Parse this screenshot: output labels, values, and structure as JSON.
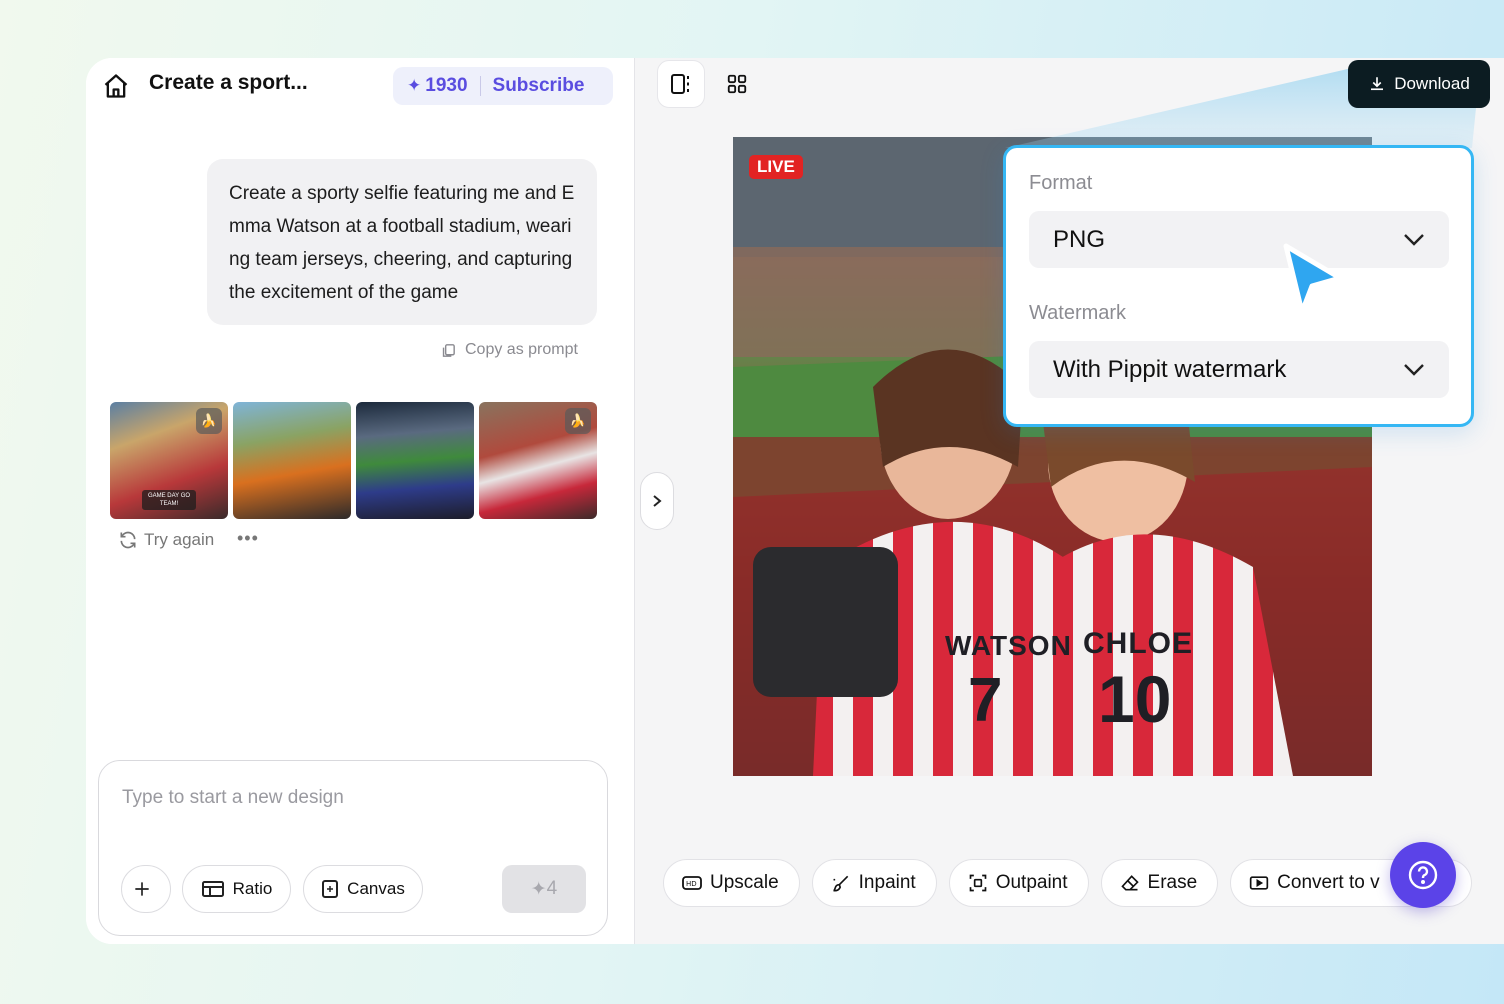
{
  "header": {
    "title": "Create a sport...",
    "credits": "1930",
    "subscribe_label": "Subscribe"
  },
  "chat": {
    "prompt_text": "Create a sporty selfie featuring me and Emma Watson at a football stadium, wearing team jerseys, cheering, and capturing the excitement of the game",
    "copy_label": "Copy as prompt",
    "thumb_badge": "GAME DAY GO TEAM!",
    "try_again_label": "Try again",
    "more_label": "•••"
  },
  "composer": {
    "placeholder": "Type to start a new design",
    "ratio_label": "Ratio",
    "canvas_label": "Canvas",
    "send_cost": "4"
  },
  "canvas": {
    "live_label": "LIVE",
    "jersey_names": [
      "WATSON",
      "CHLOE"
    ],
    "jersey_numbers": [
      "7",
      "10"
    ]
  },
  "toolbar": {
    "download_label": "Download"
  },
  "export_panel": {
    "format_label": "Format",
    "format_value": "PNG",
    "watermark_label": "Watermark",
    "watermark_value": "With Pippit watermark"
  },
  "bottom_tools": {
    "upscale": "Upscale",
    "inpaint": "Inpaint",
    "outpaint": "Outpaint",
    "erase": "Erase",
    "convert": "Convert to v"
  },
  "colors": {
    "accent": "#5a4de0",
    "help_button": "#5b43e8",
    "panel_border": "#35b7f4",
    "download_bg": "#0c1c22",
    "live_red": "#e22323"
  }
}
